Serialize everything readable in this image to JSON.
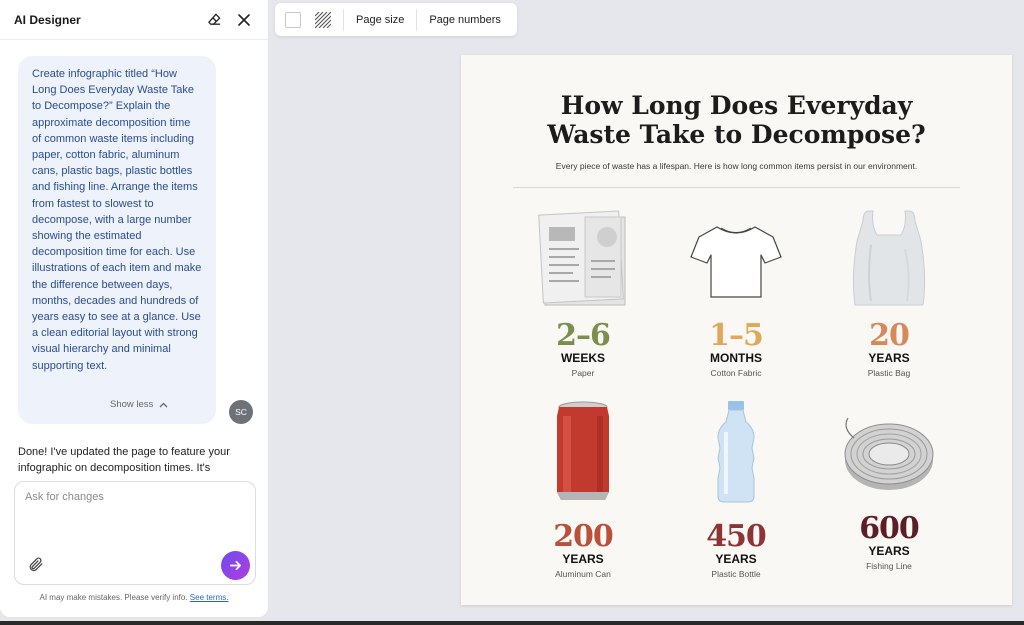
{
  "panel": {
    "title": "AI Designer",
    "user_message": "Create infographic titled “How Long Does Everyday Waste Take to Decompose?” Explain the approximate decomposition time of common waste items including paper, cotton fabric, aluminum cans, plastic bags, plastic bottles and fishing line. Arrange the items from fastest to slowest to decompose, with a large number showing the estimated decomposition time for each. Use illustrations of each item and make the difference between days, months, decades and hundreds of years easy to see at a glance. Use a clean editorial layout with strong visual hierarchy and minimal supporting text.",
    "show_less": "Show less",
    "avatar_initials": "SC",
    "assistant_message": "Done! I've updated the page to feature your infographic on decomposition times. It's",
    "input_placeholder": "Ask for changes",
    "disclaimer": "AI may make mistakes. Please verify info.",
    "disclaimer_link": "See terms."
  },
  "toolbar": {
    "page_size": "Page size",
    "page_numbers": "Page numbers"
  },
  "infographic": {
    "title": "How Long Does Everyday Waste Take to Decompose?",
    "subtitle": "Every piece of waste has a lifespan. Here is how long common items persist in our environment.",
    "items": [
      {
        "number": "2–6",
        "unit": "WEEKS",
        "label": "Paper",
        "color": "#7a8f4e",
        "icon": "newspaper-icon"
      },
      {
        "number": "1–5",
        "unit": "MONTHS",
        "label": "Cotton Fabric",
        "color": "#e0a95a",
        "icon": "tshirt-icon"
      },
      {
        "number": "20",
        "unit": "YEARS",
        "label": "Plastic Bag",
        "color": "#d9885a",
        "icon": "plastic-bag-icon"
      },
      {
        "number": "200",
        "unit": "YEARS",
        "label": "Aluminum Can",
        "color": "#b8503a",
        "icon": "soda-can-icon"
      },
      {
        "number": "450",
        "unit": "YEARS",
        "label": "Plastic Bottle",
        "color": "#8e3434",
        "icon": "water-bottle-icon"
      },
      {
        "number": "600",
        "unit": "YEARS",
        "label": "Fishing Line",
        "color": "#5c1e24",
        "icon": "fishing-line-icon"
      }
    ]
  },
  "colors": {
    "accent": "#6c4cf0",
    "user_text": "#2a4d8f",
    "user_bubble": "#eef2fb",
    "page_bg": "#faf8f4"
  }
}
